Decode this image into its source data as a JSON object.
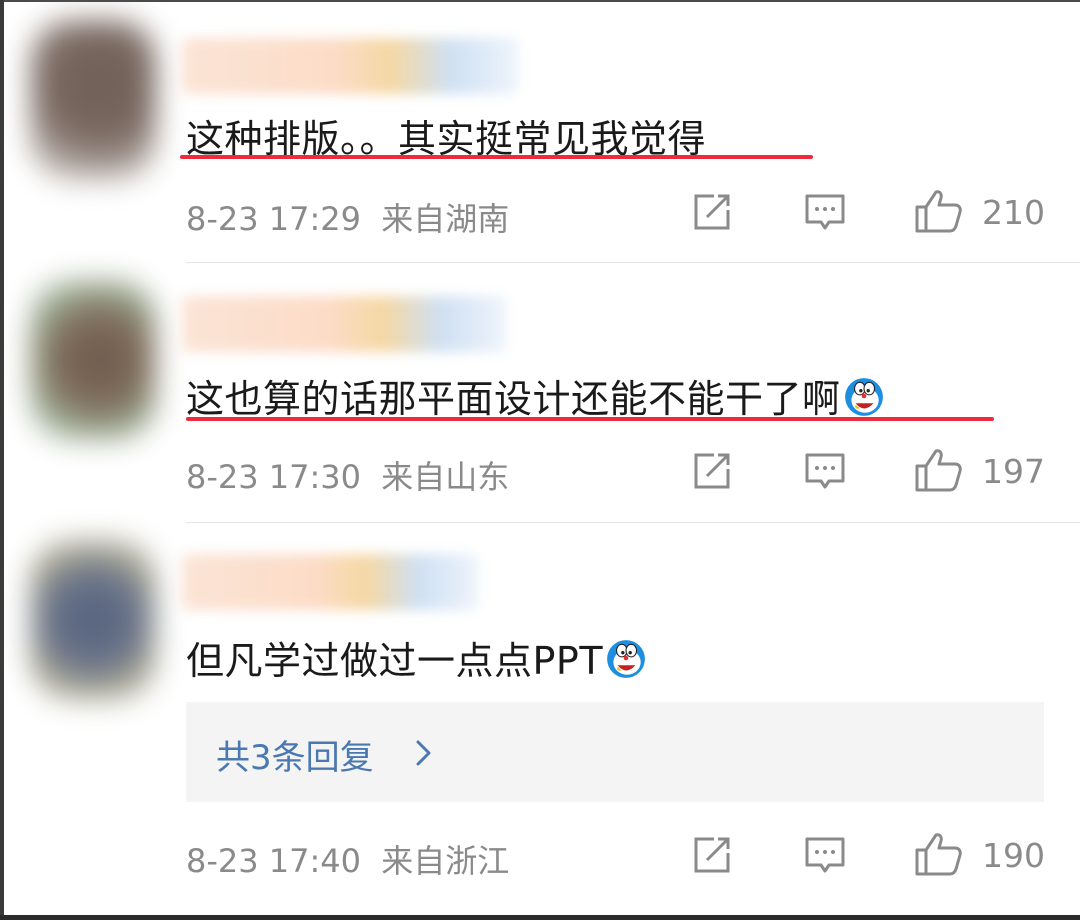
{
  "comments": [
    {
      "text": "这种排版。。其实挺常见我觉得",
      "time": "8-23 17:29",
      "location": "来自湖南",
      "likes": "210",
      "underlined": true
    },
    {
      "text": "这也算的话那平面设计还能不能干了啊",
      "emoji": "doraemon-emoji",
      "time": "8-23 17:30",
      "location": "来自山东",
      "likes": "197",
      "underlined": true
    },
    {
      "text": "但凡学过做过一点点PPT",
      "emoji": "doraemon-emoji",
      "time": "8-23 17:40",
      "location": "来自浙江",
      "likes": "190",
      "replies_label": "共3条回复",
      "underlined": false
    }
  ],
  "icons": {
    "share": "share-icon",
    "comment": "comment-icon",
    "like": "thumbs-up-icon",
    "chevron": "chevron-right-icon"
  },
  "colors": {
    "underline": "#ee2a3b",
    "link": "#4a78b0",
    "meta": "#8a8a8a",
    "text": "#1a1a1a"
  }
}
